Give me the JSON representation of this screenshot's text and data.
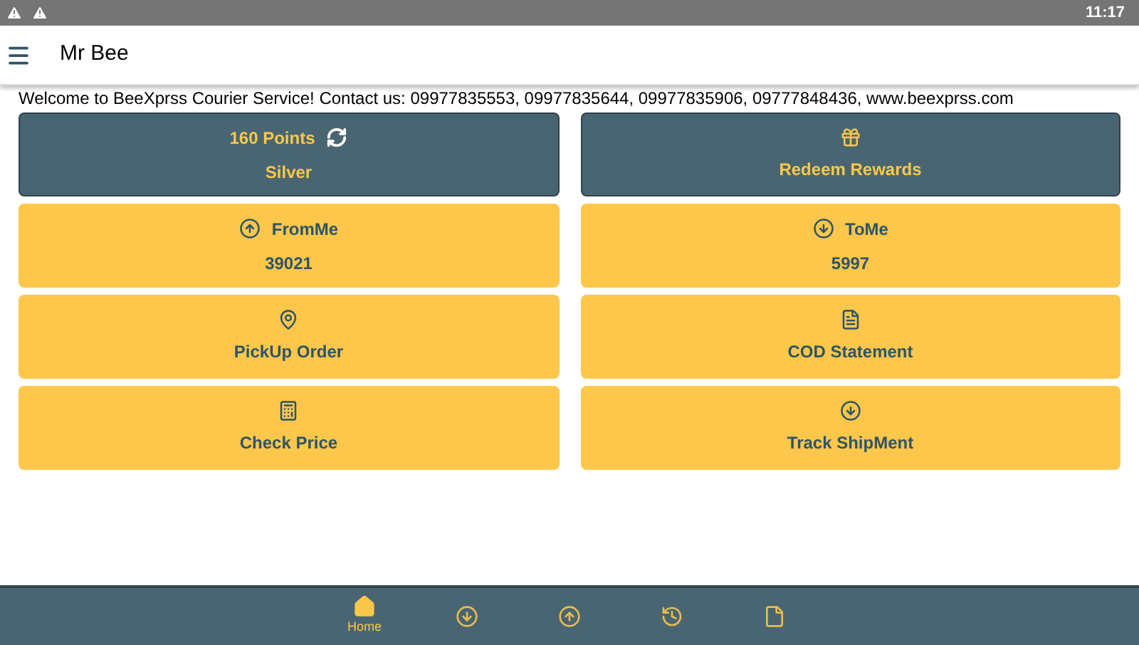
{
  "status_bar": {
    "time": "11:17"
  },
  "app_bar": {
    "title": "Mr Bee"
  },
  "welcome": "Welcome to BeeXprss Courier Service! Contact us: 09977835553, 09977835644, 09977835906, 09777848436, www.beexprss.com",
  "cards": [
    {
      "kind": "points",
      "title": "160 Points",
      "subtitle": "Silver"
    },
    {
      "kind": "dark",
      "title": "Redeem Rewards"
    },
    {
      "kind": "counter",
      "title": "FromMe",
      "subtitle": "39021"
    },
    {
      "kind": "counter",
      "title": "ToMe",
      "subtitle": "5997"
    },
    {
      "kind": "action",
      "title": "PickUp Order"
    },
    {
      "kind": "action",
      "title": "COD Statement"
    },
    {
      "kind": "action",
      "title": "Check Price"
    },
    {
      "kind": "action",
      "title": "Track ShipMent"
    }
  ],
  "bottom_nav": [
    {
      "label": "Home",
      "selected": true
    },
    {
      "selected": false
    },
    {
      "selected": false
    },
    {
      "selected": false
    },
    {
      "selected": false
    }
  ]
}
